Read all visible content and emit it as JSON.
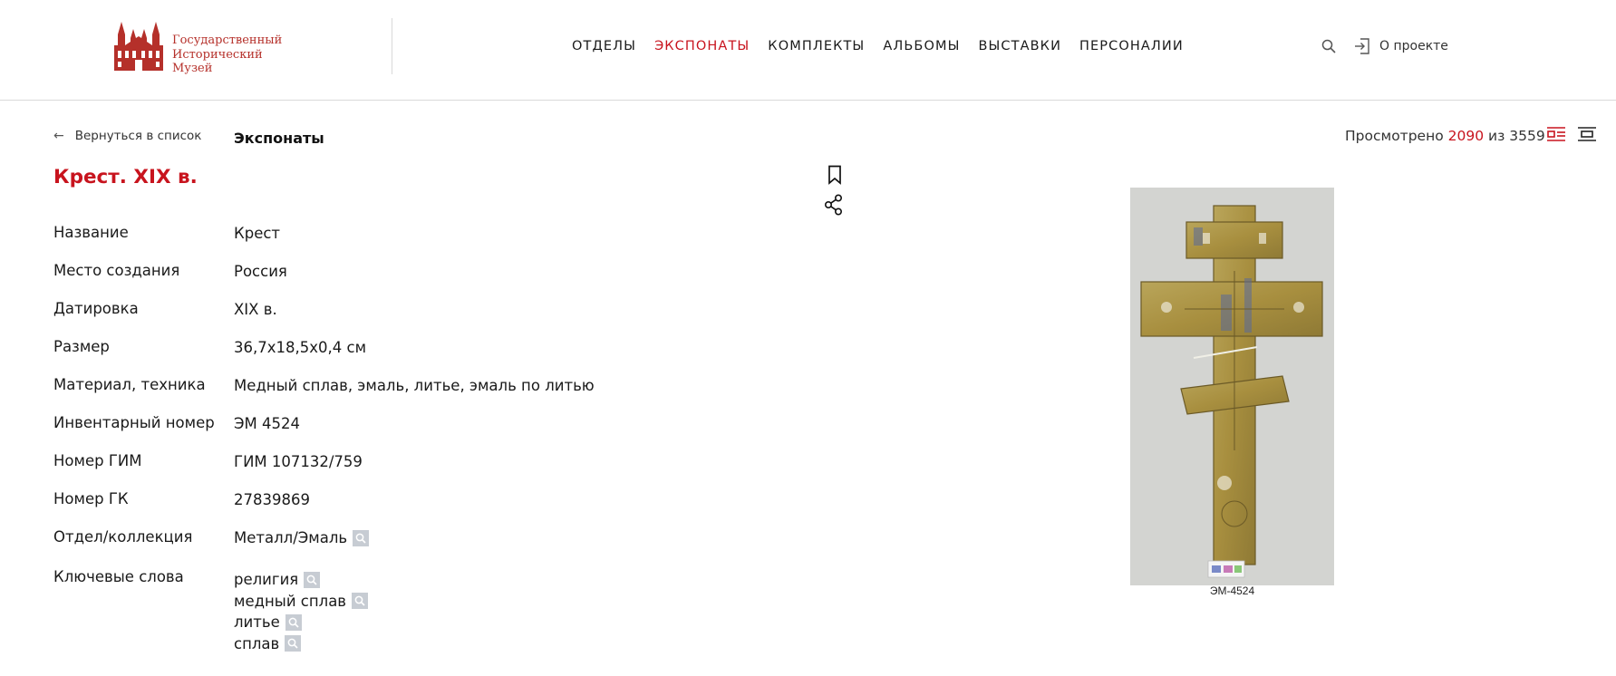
{
  "header": {
    "logo_lines": [
      "Государственный",
      "Исторический",
      "Музей"
    ],
    "nav": [
      {
        "label": "ОТДЕЛЫ",
        "active": false
      },
      {
        "label": "ЭКСПОНАТЫ",
        "active": true
      },
      {
        "label": "КОМПЛЕКТЫ",
        "active": false
      },
      {
        "label": "АЛЬБОМЫ",
        "active": false
      },
      {
        "label": "ВЫСТАВКИ",
        "active": false
      },
      {
        "label": "ПЕРСОНАЛИИ",
        "active": false
      }
    ],
    "about_label": "О проекте"
  },
  "subbar": {
    "back_arrow": "←",
    "back_label": "Вернуться в список",
    "breadcrumb": "Экспонаты",
    "counter": {
      "prefix": "Просмотрено",
      "current": "2090",
      "middle": "из",
      "total": "3559"
    }
  },
  "item": {
    "title": "Крест. XIX в.",
    "properties": [
      {
        "label": "Название",
        "value": "Крест"
      },
      {
        "label": "Место создания",
        "value": "Россия"
      },
      {
        "label": "Датировка",
        "value": "XIX в."
      },
      {
        "label": "Размер",
        "value": "36,7x18,5x0,4 см"
      },
      {
        "label": "Материал, техника",
        "value": "Медный сплав, эмаль, литье, эмаль по литью"
      },
      {
        "label": "Инвентарный номер",
        "value": "ЭМ 4524"
      },
      {
        "label": "Номер ГИМ",
        "value": "ГИМ 107132/759"
      },
      {
        "label": "Номер ГК",
        "value": "27839869"
      },
      {
        "label": "Отдел/коллекция",
        "value": "Металл/Эмаль"
      }
    ],
    "keywords_label": "Ключевые слова",
    "keywords": [
      "религия",
      "медный сплав",
      "литье",
      "сплав"
    ],
    "image_caption": "ЭМ-4524"
  },
  "colors": {
    "accent": "#c8141e",
    "logo": "#b5302a",
    "search_chip": "#c7ccd3"
  },
  "icons": [
    "museum-logo-icon",
    "search-icon",
    "login-icon",
    "view-list-icon",
    "view-single-icon",
    "bookmark-icon",
    "share-icon",
    "magnifier-icon"
  ]
}
